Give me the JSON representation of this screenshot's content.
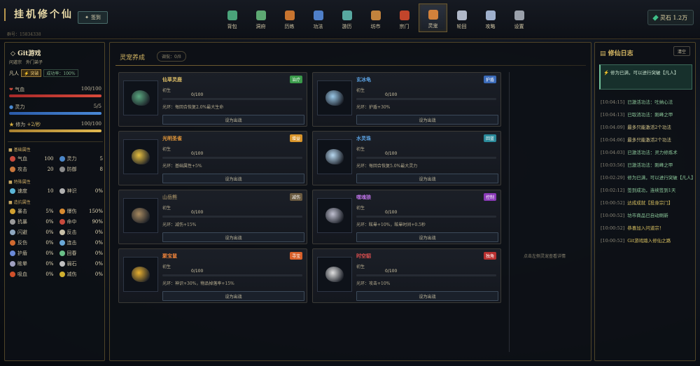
{
  "header": {
    "title": "挂机修个仙",
    "uid": "群号：15834338",
    "signin": "签到",
    "stone_label": "灵石 1.2万"
  },
  "nav": [
    {
      "label": "背包",
      "color": "#4aa37a"
    },
    {
      "label": "洞府",
      "color": "#5da872"
    },
    {
      "label": "历练",
      "color": "#c8742f"
    },
    {
      "label": "功法",
      "color": "#4f7fc8"
    },
    {
      "label": "游历",
      "color": "#58a8a0"
    },
    {
      "label": "坊市",
      "color": "#c2833d"
    },
    {
      "label": "宗门",
      "color": "#c2452b"
    },
    {
      "label": "灵宠",
      "color": "#d2813b"
    },
    {
      "label": "轮回",
      "color": "#b0b8c8"
    },
    {
      "label": "攻略",
      "color": "#9fb0cc"
    },
    {
      "label": "设置",
      "color": "#9aa0aa"
    }
  ],
  "player": {
    "name": "Git游戏",
    "sect": "问道宗",
    "role": "外门弟子",
    "rank": "凡人",
    "breakthrough": "突破",
    "success_rate": "成功率：100%",
    "hp_label": "气血",
    "hp_value": "100/100",
    "hp_fraction": 1.0,
    "mp_label": "灵力",
    "mp_value": "5/5",
    "mp_fraction": 1.0,
    "cult_label": "修为",
    "cult_rate": "+2/秒",
    "cult_value": "100/100",
    "cult_fraction": 1.0
  },
  "sections": {
    "basic": "基础属性",
    "special": "特殊属性",
    "combat": "造抗属性"
  },
  "basic_attrs": [
    {
      "k": "气血",
      "v": "100",
      "c": "#c84a3d"
    },
    {
      "k": "灵力",
      "v": "5",
      "c": "#4b86c8"
    },
    {
      "k": "攻击",
      "v": "20",
      "c": "#c8773d"
    },
    {
      "k": "防御",
      "v": "8",
      "c": "#8c8c8c"
    }
  ],
  "special_attrs": [
    {
      "k": "速度",
      "v": "10",
      "c": "#5bb6d8"
    },
    {
      "k": "神识",
      "v": "0%",
      "c": "#b0b0b0"
    }
  ],
  "combat_attrs": [
    {
      "k": "暴击",
      "v": "5%",
      "c": "#d0a030"
    },
    {
      "k": "爆伤",
      "v": "150%",
      "c": "#d88a30"
    },
    {
      "k": "抗暴",
      "v": "0%",
      "c": "#9a9a9a"
    },
    {
      "k": "命中",
      "v": "90%",
      "c": "#c84a3d"
    },
    {
      "k": "闪避",
      "v": "0%",
      "c": "#8fa8c0"
    },
    {
      "k": "反击",
      "v": "0%",
      "c": "#c8c0a8"
    },
    {
      "k": "反伤",
      "v": "0%",
      "c": "#d06a30"
    },
    {
      "k": "连击",
      "v": "0%",
      "c": "#6aa8d8"
    },
    {
      "k": "护盾",
      "v": "0%",
      "c": "#6a8ad8"
    },
    {
      "k": "回春",
      "v": "0%",
      "c": "#6ac088"
    },
    {
      "k": "眩晕",
      "v": "0%",
      "c": "#a0a0c0"
    },
    {
      "k": "弱石",
      "v": "0%",
      "c": "#c0c0c0"
    },
    {
      "k": "吸血",
      "v": "0%",
      "c": "#d0502a"
    },
    {
      "k": "减伤",
      "v": "0%",
      "c": "#d0b030"
    }
  ],
  "center": {
    "title": "灵宠养成",
    "badge": "调侃：0/8",
    "detail_hint": "点击左侧灵宠查看详情"
  },
  "pets": [
    {
      "name": "仙草灵鹿",
      "name_color": "#d8b964",
      "tag": "治疗",
      "tag_color": "#3a9a4a",
      "stage": "初生",
      "xp": "0/100",
      "effect": "光环：每回合恢复2.0%最大生命",
      "button": "设为出战",
      "icon_color": "#5aa880"
    },
    {
      "name": "玄冰龟",
      "name_color": "#5aa0e0",
      "tag": "护盾",
      "tag_color": "#3a6ab8",
      "stage": "初生",
      "xp": "0/100",
      "effect": "光环：护盾+30%",
      "button": "设为出战",
      "icon_color": "#9ac8e8"
    },
    {
      "name": "光明圣雀",
      "name_color": "#e89a3a",
      "tag": "增益",
      "tag_color": "#d8942a",
      "stage": "初生",
      "xp": "0/100",
      "effect": "光环：基础属性+5%",
      "button": "设为出战",
      "icon_color": "#e8c040"
    },
    {
      "name": "水灵珠",
      "name_color": "#5aa0e0",
      "tag": "回蓝",
      "tag_color": "#2a8a9a",
      "stage": "初生",
      "xp": "0/100",
      "effect": "光环：每回合恢复5.0%最大灵力",
      "button": "设为出战",
      "icon_color": "#b8d8f0"
    },
    {
      "name": "山岳熊",
      "name_color": "#8a7a5a",
      "tag": "减伤",
      "tag_color": "#6a5a40",
      "stage": "初生",
      "xp": "0/100",
      "effect": "光环：减伤+15%",
      "button": "设为出战",
      "icon_color": "#a88a60"
    },
    {
      "name": "噬魂狼",
      "name_color": "#b870e0",
      "tag": "控制",
      "tag_color": "#8a3ab8",
      "stage": "初生",
      "xp": "0/100",
      "effect": "光环：眩晕+10%，眩晕时间+0.5秒",
      "button": "设为出战",
      "icon_color": "#c0c0d0"
    },
    {
      "name": "聚宝鼠",
      "name_color": "#e8803a",
      "tag": "寻宝",
      "tag_color": "#d8602a",
      "stage": "初生",
      "xp": "0/100",
      "effect": "光环：神识+30%，物品掉落率+15%",
      "button": "设为出战",
      "icon_color": "#e8b030"
    },
    {
      "name": "时空貂",
      "name_color": "#e05050",
      "tag": "独角",
      "tag_color": "#b83030",
      "stage": "初生",
      "xp": "0/100",
      "effect": "光环：攻击+10%",
      "button": "设为出战",
      "icon_color": "#e0e0e0"
    }
  ],
  "log": {
    "title": "修仙日志",
    "clear": "清空",
    "notice": "修为已满，可以进行突破【凡人】",
    "entries": [
      {
        "t": "[10:04:15]",
        "m": "已激活功法：吐纳心法",
        "c": "#8cc89a"
      },
      {
        "t": "[10:04:13]",
        "m": "已取消功法：刚峰之甲",
        "c": "#8cc89a"
      },
      {
        "t": "[10:04:09]",
        "m": "最多只能激活2个功法",
        "c": "#d8c88a"
      },
      {
        "t": "[10:04:06]",
        "m": "最多只能激活2个功法",
        "c": "#d8c88a"
      },
      {
        "t": "[10:04:03]",
        "m": "已激活功法：灵力修炼术",
        "c": "#8cc89a"
      },
      {
        "t": "[10:03:56]",
        "m": "已激活功法：刚峰之甲",
        "c": "#8cc89a"
      },
      {
        "t": "[10:02:29]",
        "m": "修为已满，可以进行突破【凡人】",
        "c": "#8cc89a"
      },
      {
        "t": "[10:02:12]",
        "m": "签到成功，连续签到1天",
        "c": "#8cc89a"
      },
      {
        "t": "[10:00:52]",
        "m": "达成成就【投身宗门】",
        "c": "#d8c060"
      },
      {
        "t": "[10:00:52]",
        "m": "坊市商品已自动刷新",
        "c": "#8cc89a"
      },
      {
        "t": "[10:00:52]",
        "m": "恭喜加入问道宗！",
        "c": "#d8c060"
      },
      {
        "t": "[10:00:52]",
        "m": "Git游戏踏入修仙之路",
        "c": "#d8c060"
      }
    ]
  }
}
